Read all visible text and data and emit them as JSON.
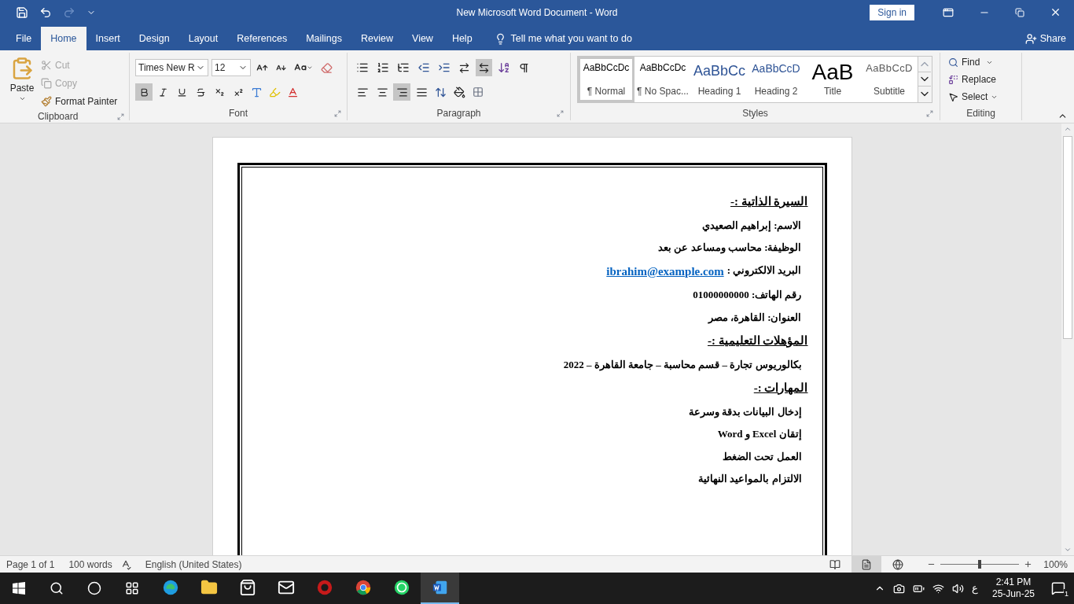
{
  "window": {
    "title": "New Microsoft Word Document  -  Word",
    "sign_in": "Sign in"
  },
  "tabs": [
    {
      "label": "File",
      "selected": false
    },
    {
      "label": "Home",
      "selected": true
    },
    {
      "label": "Insert",
      "selected": false
    },
    {
      "label": "Design",
      "selected": false
    },
    {
      "label": "Layout",
      "selected": false
    },
    {
      "label": "References",
      "selected": false
    },
    {
      "label": "Mailings",
      "selected": false
    },
    {
      "label": "Review",
      "selected": false
    },
    {
      "label": "View",
      "selected": false
    },
    {
      "label": "Help",
      "selected": false
    }
  ],
  "tell_me": "Tell me what you want to do",
  "share": "Share",
  "clipboard": {
    "label": "Clipboard",
    "paste": "Paste",
    "cut": {
      "label": "Cut",
      "disabled": true
    },
    "copy": {
      "label": "Copy",
      "disabled": true
    },
    "format_painter": "Format Painter"
  },
  "font": {
    "label": "Font",
    "name": "Times New R",
    "size": "12",
    "format_buttons": [
      {
        "kind": "bold",
        "selected": true
      },
      {
        "kind": "italic",
        "selected": false
      },
      {
        "kind": "underline",
        "selected": false
      },
      {
        "kind": "strike",
        "selected": false
      },
      {
        "kind": "sub",
        "selected": false
      },
      {
        "kind": "sup",
        "selected": false
      }
    ]
  },
  "paragraph": {
    "label": "Paragraph",
    "ltr_selected": false,
    "rtl_selected": true,
    "show_marks_selected": false,
    "align": [
      {
        "kind": "left",
        "selected": false
      },
      {
        "kind": "center",
        "selected": false
      },
      {
        "kind": "right",
        "selected": true
      },
      {
        "kind": "justify",
        "selected": false
      }
    ]
  },
  "styles": {
    "label": "Styles",
    "items": [
      {
        "preview": "AaBbCcDc",
        "name": "¶ Normal",
        "kind": "normal",
        "selected": true
      },
      {
        "preview": "AaBbCcDc",
        "name": "¶ No Spac...",
        "kind": "normal",
        "selected": false
      },
      {
        "preview": "AaBbCc",
        "name": "Heading 1",
        "kind": "heading1",
        "selected": false
      },
      {
        "preview": "AaBbCcD",
        "name": "Heading 2",
        "kind": "heading2",
        "selected": false
      },
      {
        "preview": "AaB",
        "name": "Title",
        "kind": "title",
        "selected": false
      },
      {
        "preview": "AaBbCcD",
        "name": "Subtitle",
        "kind": "subtitle",
        "selected": false
      }
    ]
  },
  "editing": {
    "label": "Editing",
    "find": "Find",
    "replace": "Replace",
    "select": "Select"
  },
  "document": {
    "paragraphs": [
      {
        "kind": "heading",
        "text": "السيرة الذاتية :-"
      },
      {
        "kind": "line",
        "text": "الاسم: إبراهيم الصعيدي"
      },
      {
        "kind": "line",
        "text": "الوظيفة: محاسب ومساعد عن بعد"
      },
      {
        "kind": "link_line",
        "text": "البريد الالكتروني :",
        "link": "ibrahim@example.com"
      },
      {
        "kind": "line",
        "text": "رقم الهاتف: 01000000000"
      },
      {
        "kind": "line",
        "text": "العنوان: القاهرة، مصر"
      },
      {
        "kind": "heading",
        "text": "المؤهلات التعليمية :-"
      },
      {
        "kind": "line",
        "text": "بكالوريوس تجارة – قسم محاسبة – جامعة القاهرة – 2022"
      },
      {
        "kind": "heading",
        "text": "المهارات :-"
      },
      {
        "kind": "line",
        "text": "إدخال البيانات بدقة وسرعة"
      },
      {
        "kind": "line",
        "text": "إتقان Excel و Word"
      },
      {
        "kind": "line",
        "text": "العمل تحت الضغط"
      },
      {
        "kind": "line",
        "text": "الالتزام بالمواعيد النهائية"
      }
    ]
  },
  "status_bar": {
    "page": "Page 1 of 1",
    "words": "100 words",
    "language": "English (United States)",
    "zoom": "100%",
    "zoom_level": {
      "level": 0.5
    },
    "views": [
      {
        "kind": "read",
        "selected": false
      },
      {
        "kind": "print",
        "selected": true
      },
      {
        "kind": "web",
        "selected": false
      }
    ]
  },
  "taskbar": {
    "apps": [
      {
        "kind": "edge",
        "selected": false
      },
      {
        "kind": "folder",
        "selected": false
      },
      {
        "kind": "store",
        "selected": false
      },
      {
        "kind": "mail",
        "selected": false
      },
      {
        "kind": "game",
        "selected": false
      },
      {
        "kind": "chrome",
        "selected": false
      },
      {
        "kind": "whatsapp",
        "selected": false
      },
      {
        "kind": "word",
        "selected": true
      }
    ],
    "input_language": "ع",
    "time": "2:41 PM",
    "date": "25-Jun-25",
    "notifications": "1"
  }
}
